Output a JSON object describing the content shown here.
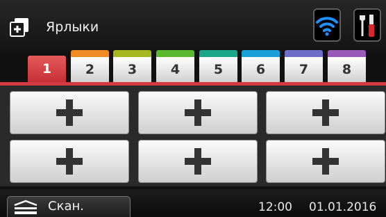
{
  "header": {
    "title": "Ярлыки",
    "app_icon": "shortcut-add-icon",
    "wifi_icon": "wifi-icon",
    "tools_icon": "settings-tools-icon",
    "wifi_color": "#1e90ff"
  },
  "tabs": [
    {
      "label": "1",
      "color": "#d23a41",
      "active": true
    },
    {
      "label": "2",
      "color": "#f08a24"
    },
    {
      "label": "3",
      "color": "#a6b820"
    },
    {
      "label": "4",
      "color": "#5cb82e"
    },
    {
      "label": "5",
      "color": "#1aa68a"
    },
    {
      "label": "6",
      "color": "#1a9fd6"
    },
    {
      "label": "7",
      "color": "#6e6ec8"
    },
    {
      "label": "8",
      "color": "#9a5ab8"
    }
  ],
  "shortcut_buttons": [
    {
      "icon": "plus-icon"
    },
    {
      "icon": "plus-icon"
    },
    {
      "icon": "plus-icon"
    },
    {
      "icon": "plus-icon"
    },
    {
      "icon": "plus-icon"
    },
    {
      "icon": "plus-icon"
    }
  ],
  "footer": {
    "scan_label": "Скан.",
    "scan_icon": "scan-icon",
    "time": "12:00",
    "date": "01.01.2016"
  }
}
